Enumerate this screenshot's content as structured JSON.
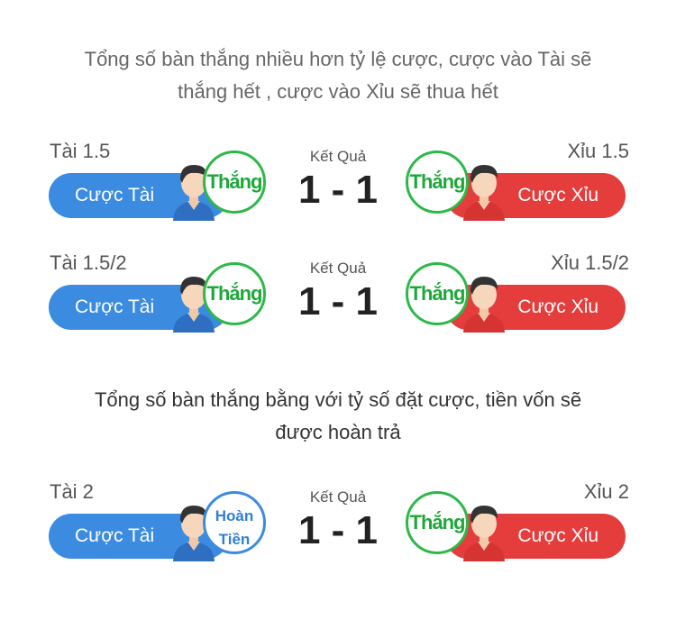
{
  "sections": [
    {
      "description_line1": "Tổng số bàn thắng nhiều hơn tỷ lệ cược, cược vào Tài sẽ",
      "description_line2": "thắng hết , cược vào Xỉu sẽ thua hết"
    },
    {
      "description_line1": "Tổng số bàn thắng bằng với tỷ số đặt cược, tiền vốn sẽ",
      "description_line2": "được hoàn trả"
    }
  ],
  "rows": [
    {
      "over_label": "Tài 1.5",
      "under_label": "Xỉu 1.5",
      "over_button": "Cược Tài",
      "under_button": "Cược Xỉu",
      "over_badge": "Thắng",
      "under_badge": "Thắng",
      "result_label": "Kết Quả",
      "score": "1 - 1"
    },
    {
      "over_label": "Tài 1.5/2",
      "under_label": "Xỉu 1.5/2",
      "over_button": "Cược Tài",
      "under_button": "Cược Xỉu",
      "over_badge": "Thắng",
      "under_badge": "Thắng",
      "result_label": "Kết Quả",
      "score": "1 - 1"
    },
    {
      "over_label": "Tài 2",
      "under_label": "Xỉu 2",
      "over_button": "Cược Tài",
      "under_button": "Cược Xỉu",
      "over_badge_line1": "Hoàn",
      "over_badge_line2": "Tiền",
      "under_badge": "Thắng",
      "result_label": "Kết Quả",
      "score": "1 - 1"
    }
  ],
  "colors": {
    "over_blue": "#3b8be0",
    "under_red": "#e53c3c",
    "win_green": "#2db84a",
    "refund_blue": "#3b8be0"
  },
  "icons": [
    "player-avatar-blue-icon",
    "player-avatar-red-icon"
  ]
}
